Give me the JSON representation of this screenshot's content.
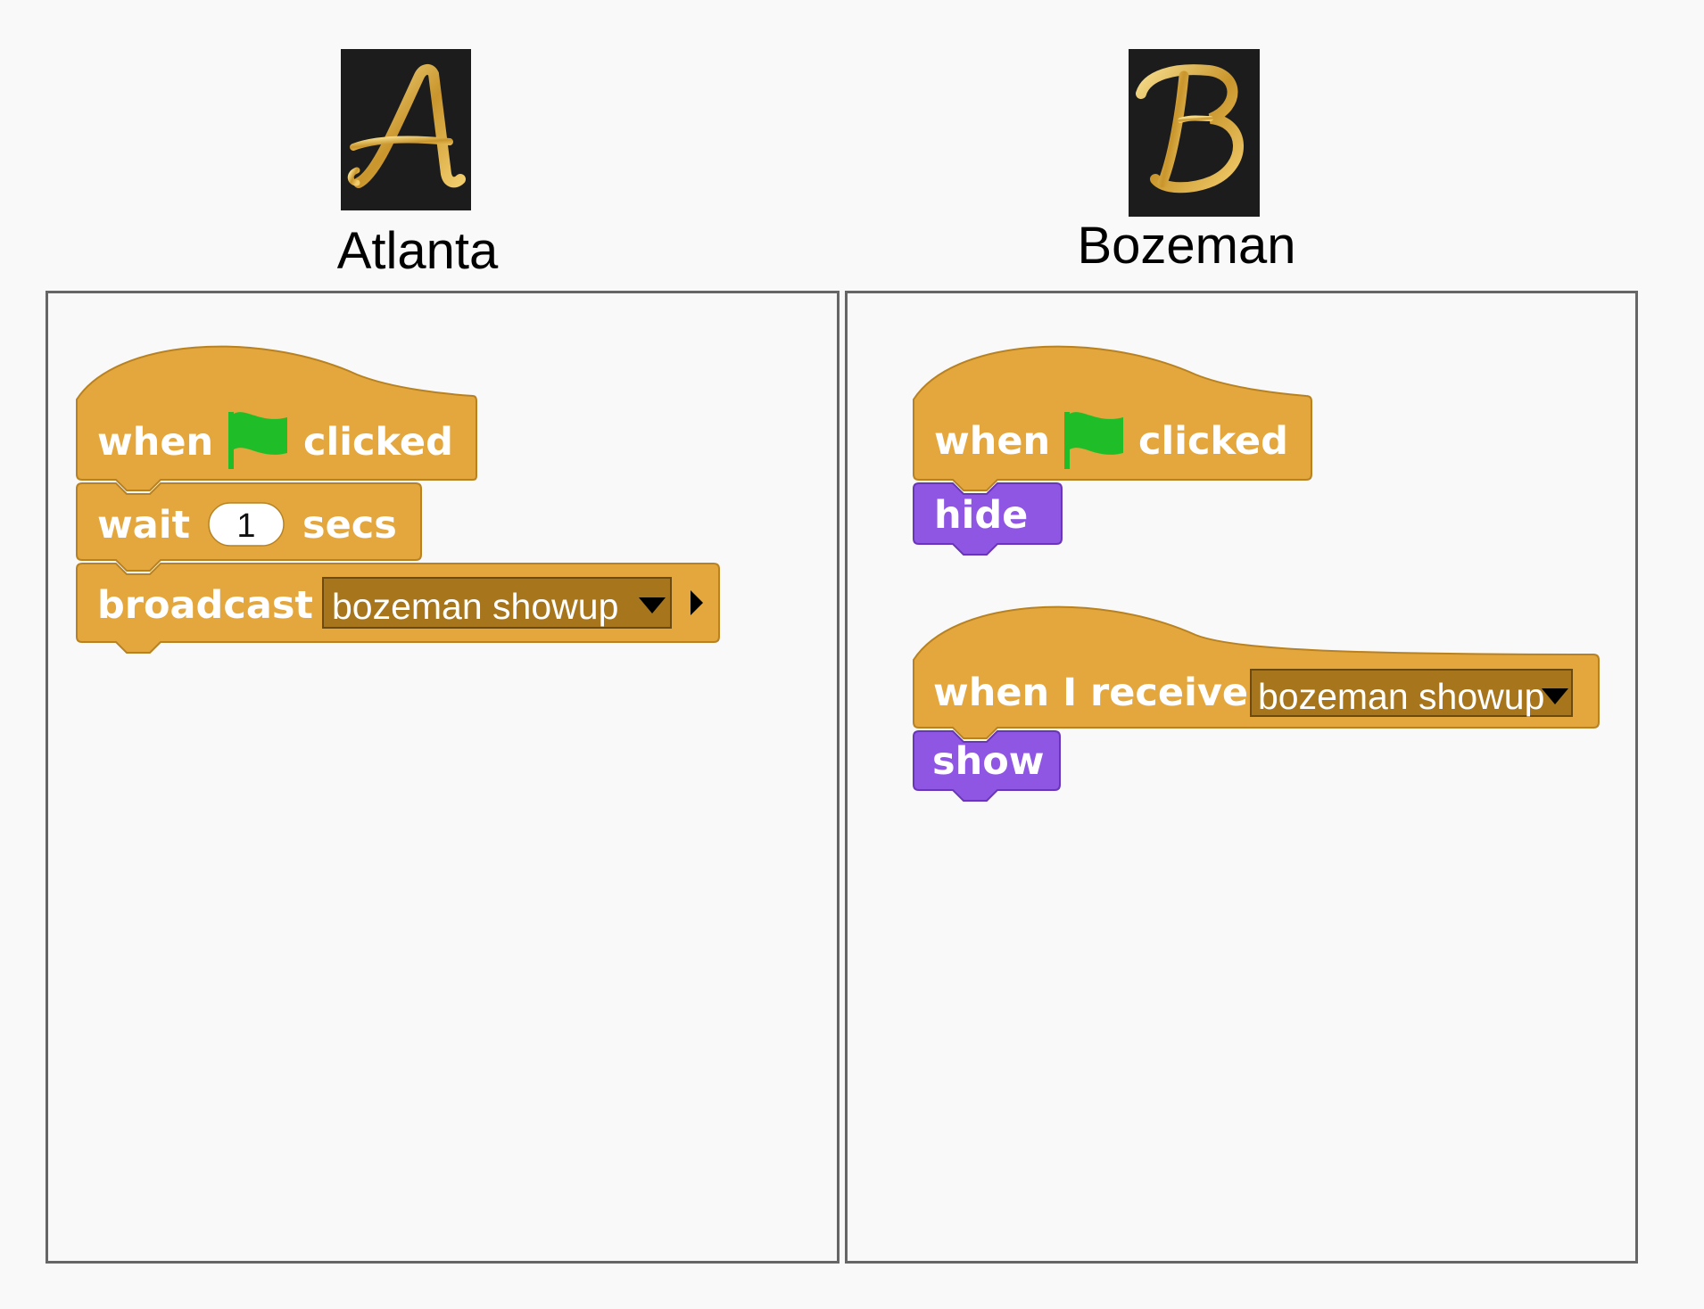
{
  "colors": {
    "control": "#e3a73e",
    "control_edge": "#b88222",
    "looks": "#8f56e3",
    "looks_edge": "#6a36b8",
    "flag": "#1fbe28",
    "slot_dark": "#a6751c",
    "panel_border": "#666666",
    "background": "#f9f9f9"
  },
  "sprites": [
    {
      "name": "Atlanta",
      "costume_letter": "A",
      "costume_icon": "gold-script-letter-a"
    },
    {
      "name": "Bozeman",
      "costume_letter": "B",
      "costume_icon": "gold-script-letter-b"
    }
  ],
  "scripts": {
    "atlanta": {
      "hat": {
        "when": "when",
        "clicked": "clicked",
        "flag_icon": "green-flag-icon"
      },
      "wait": {
        "label": "wait",
        "value": "1",
        "unit": "secs"
      },
      "broadcast": {
        "label": "broadcast",
        "message": "bozeman showup"
      }
    },
    "bozeman": {
      "hat": {
        "when": "when",
        "clicked": "clicked",
        "flag_icon": "green-flag-icon"
      },
      "hide": {
        "label": "hide"
      },
      "receive": {
        "label": "when I receive",
        "message": "bozeman showup"
      },
      "show": {
        "label": "show"
      }
    }
  }
}
